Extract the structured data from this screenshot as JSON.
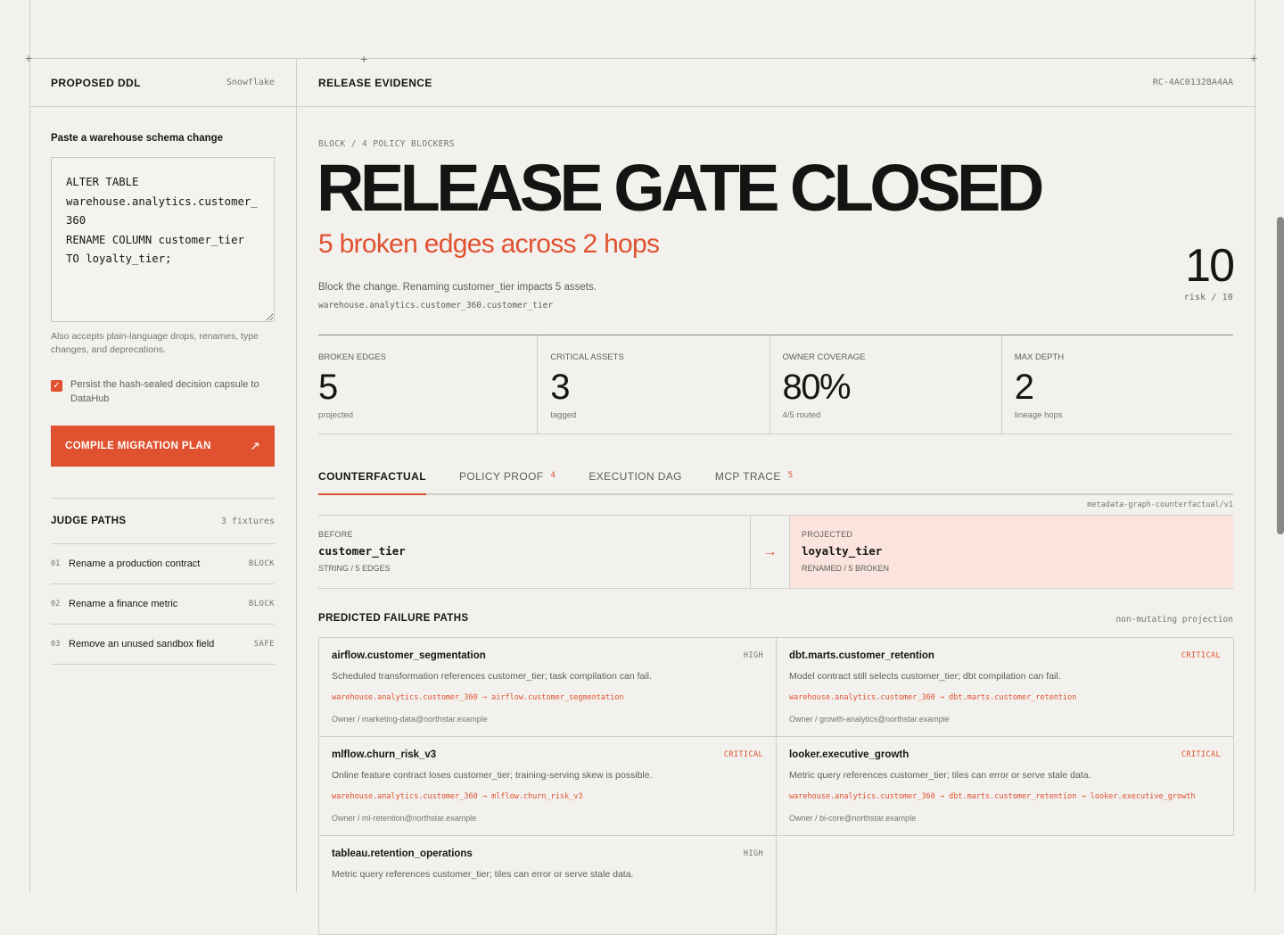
{
  "left": {
    "title": "PROPOSED DDL",
    "dialect": "Snowflake",
    "input_label": "Paste a warehouse schema change",
    "ddl_value": "ALTER TABLE\nwarehouse.analytics.customer_\n360\nRENAME COLUMN customer_tier\nTO loyalty_tier;",
    "hint": "Also accepts plain-language drops, renames, type changes, and deprecations.",
    "persist_checked": true,
    "persist_label": "Persist the hash-sealed decision capsule to DataHub",
    "compile_label": "COMPILE MIGRATION PLAN",
    "compile_icon": "↗",
    "judge_title": "JUDGE PATHS",
    "judge_count": "3 fixtures",
    "judge_items": [
      {
        "num": "01",
        "name": "Rename a production contract",
        "status": "BLOCK"
      },
      {
        "num": "02",
        "name": "Rename a finance metric",
        "status": "BLOCK"
      },
      {
        "num": "03",
        "name": "Remove an unused sandbox field",
        "status": "SAFE"
      }
    ]
  },
  "right": {
    "title": "RELEASE EVIDENCE",
    "release_id": "RC-4AC01328A4AA",
    "eyebrow": "BLOCK / 4 POLICY BLOCKERS",
    "hero": "RELEASE GATE CLOSED",
    "subhead": "5 broken edges across 2 hops",
    "description": "Block the change. Renaming customer_tier impacts 5 assets.",
    "column_path": "warehouse.analytics.customer_360.customer_tier",
    "risk_value": "10",
    "risk_label": "risk / 10",
    "stats": [
      {
        "key": "BROKEN EDGES",
        "value": "5",
        "detail": "projected"
      },
      {
        "key": "CRITICAL ASSETS",
        "value": "3",
        "detail": "tagged"
      },
      {
        "key": "OWNER COVERAGE",
        "value": "80%",
        "detail": "4/5 routed"
      },
      {
        "key": "MAX DEPTH",
        "value": "2",
        "detail": "lineage hops"
      }
    ],
    "tabs": [
      {
        "label": "COUNTERFACTUAL",
        "count": ""
      },
      {
        "label": "POLICY PROOF",
        "count": "4"
      },
      {
        "label": "EXECUTION DAG",
        "count": ""
      },
      {
        "label": "MCP TRACE",
        "count": "5"
      }
    ],
    "graph_id": "metadata-graph-counterfactual/v1",
    "before": {
      "key": "BEFORE",
      "value": "customer_tier",
      "detail": "STRING / 5 EDGES"
    },
    "arrow": "→",
    "projected": {
      "key": "PROJECTED",
      "value": "loyalty_tier",
      "detail": "RENAMED / 5 BROKEN"
    },
    "failure_title": "PREDICTED FAILURE PATHS",
    "failure_sub": "non-mutating projection",
    "failures": [
      {
        "name": "airflow.customer_segmentation",
        "severity": "HIGH",
        "message": "Scheduled transformation references customer_tier; task compilation can fail.",
        "edge": "warehouse.analytics.customer_360 → airflow.customer_segmentation",
        "owner": "Owner / marketing-data@northstar.example"
      },
      {
        "name": "dbt.marts.customer_retention",
        "severity": "CRITICAL",
        "message": "Model contract still selects customer_tier; dbt compilation can fail.",
        "edge": "warehouse.analytics.customer_360 → dbt.marts.customer_retention",
        "owner": "Owner / growth-analytics@northstar.example"
      },
      {
        "name": "mlflow.churn_risk_v3",
        "severity": "CRITICAL",
        "message": "Online feature contract loses customer_tier; training-serving skew is possible.",
        "edge": "warehouse.analytics.customer_360 → mlflow.churn_risk_v3",
        "owner": "Owner / ml-retention@northstar.example"
      },
      {
        "name": "looker.executive_growth",
        "severity": "CRITICAL",
        "message": "Metric query references customer_tier; tiles can error or serve stale data.",
        "edge": "warehouse.analytics.customer_360 → dbt.marts.customer_retention → looker.executive_growth",
        "owner": "Owner / bi-core@northstar.example"
      },
      {
        "name": "tableau.retention_operations",
        "severity": "HIGH",
        "message": "Metric query references customer_tier; tiles can error or serve stale data.",
        "edge": "",
        "owner": ""
      }
    ]
  },
  "colors": {
    "accent": "#e0512f",
    "projected_bg": "#fae4dd",
    "background": "#f2f1ee"
  }
}
